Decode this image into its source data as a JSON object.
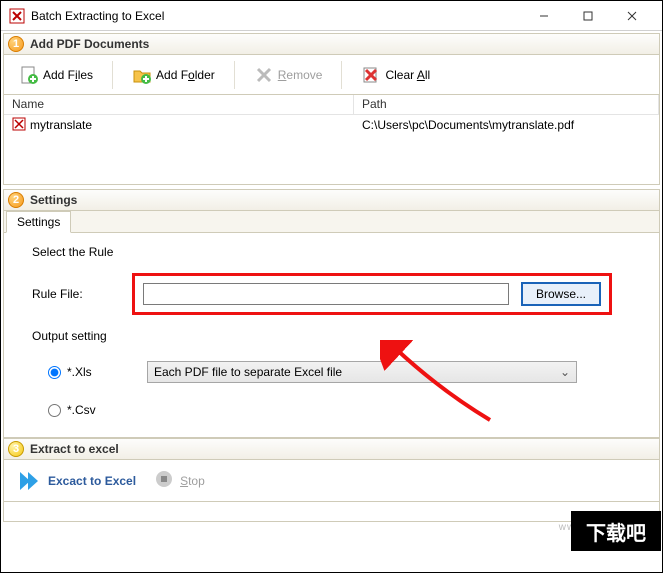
{
  "window": {
    "title": "Batch Extracting to Excel"
  },
  "sections": {
    "add": {
      "num": "1",
      "label": "Add PDF Documents"
    },
    "settings": {
      "num": "2",
      "label": "Settings"
    },
    "extract": {
      "num": "3",
      "label": "Extract to excel"
    }
  },
  "toolbar": {
    "addFiles": {
      "pre": "Add F",
      "u": "i",
      "post": "les"
    },
    "addFolder": {
      "pre": "Add F",
      "u": "o",
      "post": "lder"
    },
    "remove": {
      "u": "R",
      "post": "emove"
    },
    "clearAll": {
      "pre": "Clear ",
      "u": "A",
      "post": "ll"
    }
  },
  "list": {
    "cols": {
      "name": "Name",
      "path": "Path"
    },
    "rows": [
      {
        "name": "mytranslate",
        "path": "C:\\Users\\pc\\Documents\\mytranslate.pdf"
      }
    ]
  },
  "settings": {
    "tab": "Settings",
    "selectRule": "Select the Rule",
    "ruleFile": "Rule File:",
    "ruleValue": "",
    "browse": "Browse...",
    "outputSetting": "Output setting",
    "xls": "*.Xls",
    "csv": "*.Csv",
    "outputMode": "Each PDF file to separate Excel file"
  },
  "extract": {
    "go": "Excact to Excel",
    "stop": {
      "u": "S",
      "post": "top"
    }
  },
  "watermark": "www.xiazaiba.com",
  "cornerlogo": "下载吧"
}
